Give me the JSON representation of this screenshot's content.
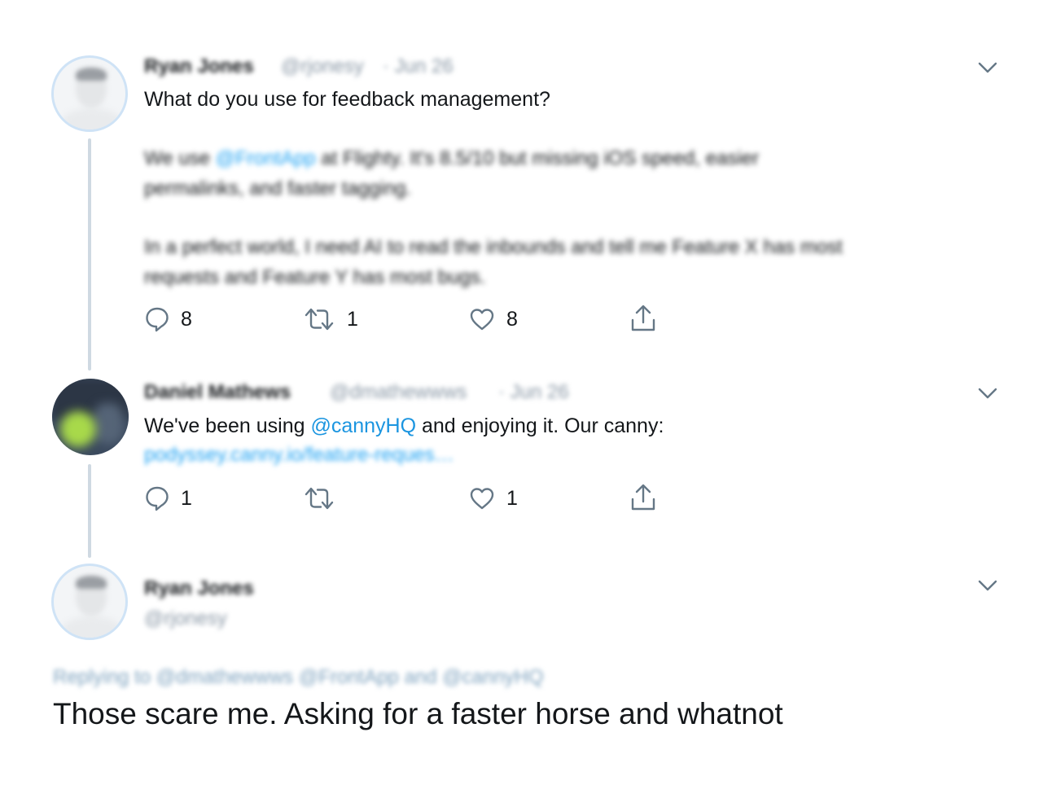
{
  "tweets": [
    {
      "author_name": "Ryan Jones",
      "author_handle": "@rjonesy",
      "date": "· Jun 26",
      "text": "What do you use for feedback management?",
      "quoted_lines": [
        {
          "pre": "We use ",
          "link": "@FrontApp",
          "post": " at Flighty. It's 8.5/10 but missing iOS speed, easier"
        },
        {
          "pre": "permalinks, and faster tagging.",
          "link": "",
          "post": ""
        },
        {
          "pre": "In a perfect world, I need AI to read the inbounds and tell me Feature X has most",
          "link": "",
          "post": ""
        },
        {
          "pre": "requests and Feature Y has most bugs.",
          "link": "",
          "post": ""
        }
      ],
      "actions": {
        "reply_count": "8",
        "retweet_count": "1",
        "like_count": "8"
      }
    },
    {
      "author_name": "Daniel Mathews",
      "author_handle": "@dmathewwws",
      "date": "· Jun 26",
      "text_pre": "We've been using ",
      "text_mention": "@cannyHQ",
      "text_post": " and enjoying it. Our canny:",
      "link": "podyssey.canny.io/feature-reques…",
      "actions": {
        "reply_count": "1",
        "retweet_count": "",
        "like_count": "1"
      }
    },
    {
      "author_name": "Ryan Jones",
      "author_handle": "@rjonesy",
      "replying_to": "Replying to @dmathewwws @FrontApp and @cannyHQ",
      "text": "Those scare me. Asking for a faster horse and whatnot"
    }
  ],
  "icons": {
    "reply": "reply-icon",
    "retweet": "retweet-icon",
    "like": "heart-icon",
    "share": "share-icon",
    "more": "chevron-down-icon"
  },
  "colors": {
    "mention": "#1b95e0",
    "thread_line": "#cfd9e2",
    "icon": "#657786",
    "text": "#14171a"
  }
}
